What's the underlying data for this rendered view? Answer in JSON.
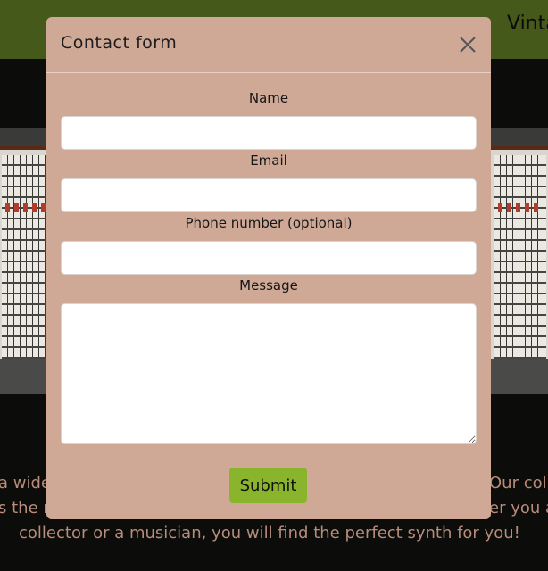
{
  "site": {
    "brand": "Vinta",
    "intro_lines": [
      "a wide",
      "Our col",
      "s the m",
      "er you a",
      "collector or a musician, you will find the perfect synth for you!"
    ]
  },
  "modal": {
    "title": "Contact form",
    "fields": {
      "name_label": "Name",
      "name_value": "",
      "email_label": "Email",
      "email_value": "",
      "phone_label": "Phone number (optional)",
      "phone_value": "",
      "message_label": "Message",
      "message_value": ""
    },
    "submit_label": "Submit",
    "close_icon": "close-icon"
  },
  "colors": {
    "header_bg": "#44591a",
    "modal_bg": "#cfa896",
    "submit_bg": "#8ab42c",
    "intro_text": "#b88c7a"
  }
}
